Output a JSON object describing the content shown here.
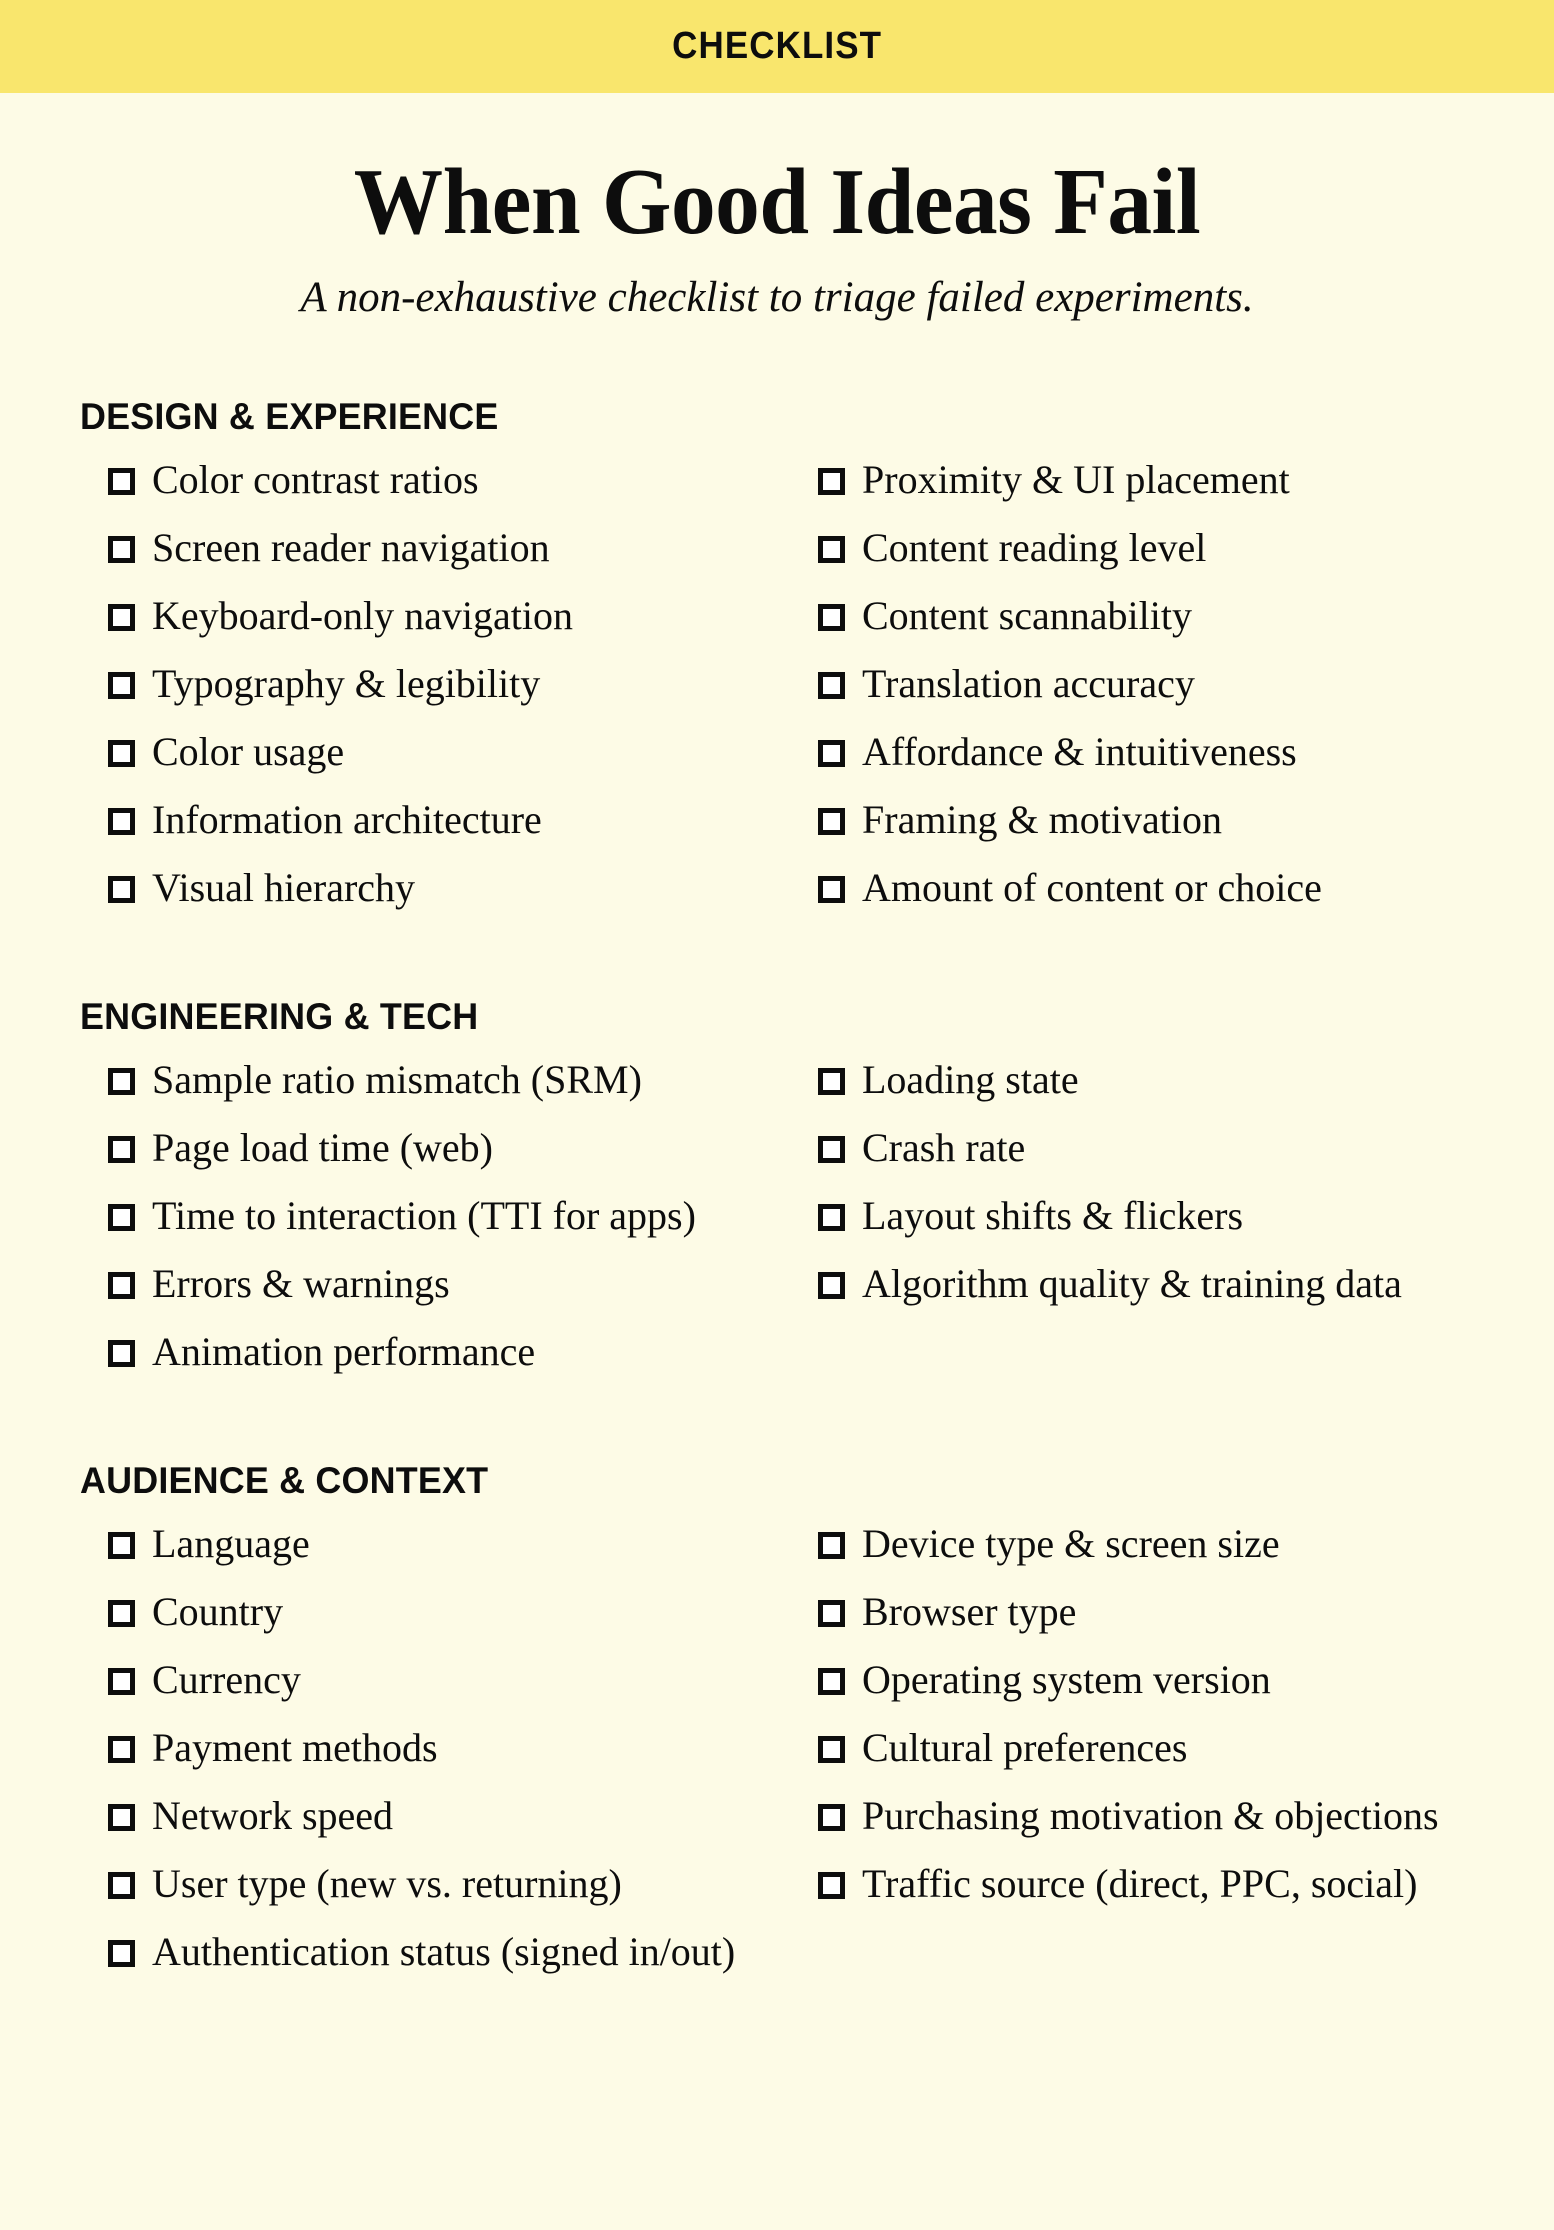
{
  "kicker": "CHECKLIST",
  "title": "When Good Ideas Fail",
  "subtitle": "A non-exhaustive checklist to triage failed experiments.",
  "colors": {
    "band": "#F9E66D",
    "page": "#FDFBE6",
    "ink": "#0D0D0D",
    "checkbox_fill": "#FFFFFF"
  },
  "sections": [
    {
      "heading": "DESIGN & EXPERIENCE",
      "left": [
        "Color contrast ratios",
        "Screen reader navigation",
        "Keyboard-only navigation",
        "Typography & legibility",
        "Color usage",
        "Information architecture",
        "Visual hierarchy"
      ],
      "right": [
        "Proximity & UI placement",
        "Content reading level",
        "Content scannability",
        "Translation accuracy",
        "Affordance & intuitiveness",
        "Framing & motivation",
        "Amount of content or choice"
      ]
    },
    {
      "heading": "ENGINEERING & TECH",
      "left": [
        "Sample ratio mismatch (SRM)",
        "Page load time (web)",
        "Time to interaction (TTI for apps)",
        "Errors & warnings",
        "Animation performance"
      ],
      "right": [
        "Loading state",
        "Crash rate",
        "Layout shifts & flickers",
        "Algorithm quality & training data"
      ]
    },
    {
      "heading": "AUDIENCE & CONTEXT",
      "left": [
        "Language",
        "Country",
        "Currency",
        "Payment methods",
        "Network speed",
        "User type (new vs. returning)",
        "Authentication status (signed in/out)"
      ],
      "right": [
        "Device type & screen size",
        "Browser type",
        "Operating system version",
        "Cultural preferences",
        "Purchasing motivation & objections",
        "Traffic source (direct, PPC, social)"
      ]
    }
  ]
}
